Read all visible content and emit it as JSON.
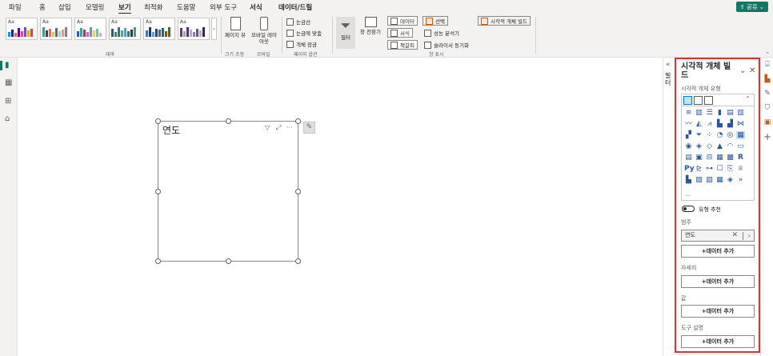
{
  "menu": {
    "items": [
      "파일",
      "홈",
      "삽입",
      "모델링",
      "보기",
      "최적화",
      "도움말",
      "외부 도구",
      "서식",
      "데이터/드릴"
    ],
    "share_label": "공유"
  },
  "ribbon": {
    "theme_thumb_label": "Aa",
    "themes_group_label": "테마",
    "page_view_label": "페이지 뷰",
    "mobile_layout_label": "모바일 레이아웃",
    "size_group_label": "크기 조정",
    "mobile_group_label": "모바일",
    "gridlines_label": "눈금선",
    "snap_to_grid_label": "눈금에 맞춤",
    "lock_objects_label": "개체 잠금",
    "page_options_group_label": "페이지 옵션",
    "filters_label": "필터",
    "bookmarks_btn_label": "창 전환기",
    "data_btn_label": "데이터",
    "format_btn_label": "서식",
    "bookmarks_label": "책갈피",
    "selection_label": "선택",
    "perf_analyzer_label": "성능 분석기",
    "sync_slicers_label": "슬라이서 동기화",
    "build_visual_label": "시각적 개체 빌드",
    "show_panes_group_label": "창 표시"
  },
  "visual": {
    "title": "연도"
  },
  "filter_pane": {
    "collapsed_label": "필터"
  },
  "viz_pane": {
    "title": "시각적 개체 빌드",
    "subtitle": "시각적 개체 유형",
    "more_label": "···",
    "type_suggest_label": "유형 추천",
    "category_label": "범주",
    "category_field": "연도",
    "details_label": "자세히",
    "values_label": "값",
    "tooltips_label": "도구 설명",
    "add_data_label": "+데이터 추가"
  },
  "colors": {
    "accent_green": "#117865",
    "highlight_red": "#e03131",
    "ribbon_bg": "#f3f2f1"
  },
  "icons": [
    "report-view-icon",
    "table-view-icon",
    "model-view-icon",
    "dax-query-icon",
    "filter-icon",
    "focus-mode-icon",
    "more-options-icon",
    "format-brush-icon",
    "close-icon",
    "chevron-down-icon",
    "build-visual-icon",
    "format-visual-icon",
    "bookmark-icon",
    "selection-icon",
    "add-icon"
  ]
}
